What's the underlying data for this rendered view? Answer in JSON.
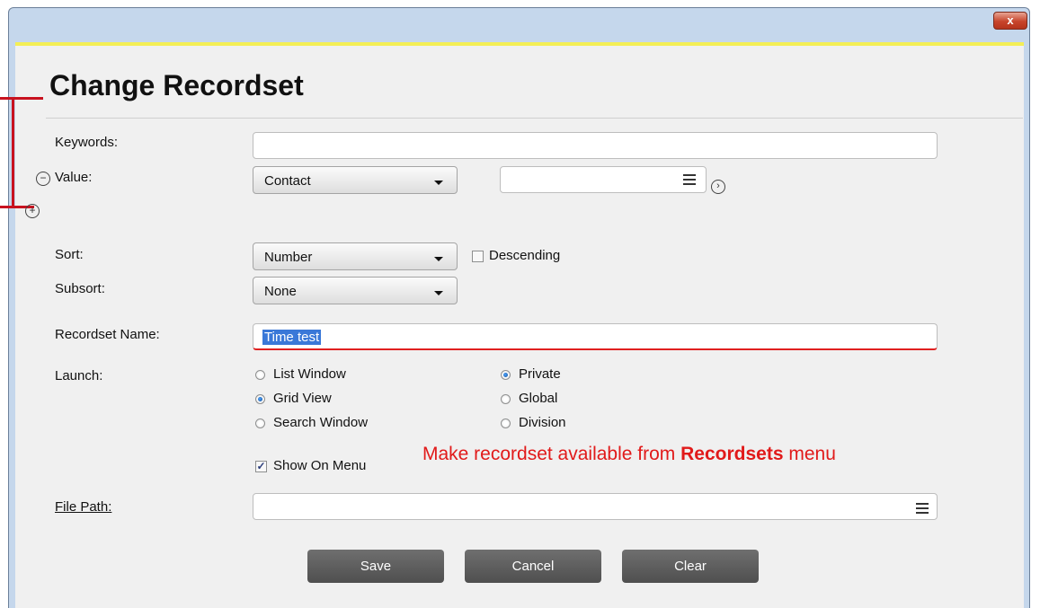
{
  "dialog": {
    "title": "Change Recordset",
    "close_glyph": "x"
  },
  "form": {
    "keywords_label": "Keywords:",
    "keywords_value": "",
    "value_label": "Value:",
    "value_dropdown": "Contact",
    "value_input": "",
    "sort_label": "Sort:",
    "sort_value": "Number",
    "descending_label": "Descending",
    "descending_checked": false,
    "subsort_label": "Subsort:",
    "subsort_value": "None",
    "recordset_name_label": "Recordset Name:",
    "recordset_name_value": "Time test",
    "launch_label": "Launch:",
    "launch_options": [
      "List Window",
      "Grid View",
      "Search Window"
    ],
    "launch_selected": "Grid View",
    "scope_options": [
      "Private",
      "Global",
      "Division"
    ],
    "scope_selected": "Private",
    "show_on_menu_label": "Show On Menu",
    "show_on_menu_checked": true,
    "file_path_label": "File Path:",
    "file_path_value": ""
  },
  "buttons": {
    "save": "Save",
    "cancel": "Cancel",
    "clear": "Clear"
  },
  "annotation": {
    "text_before": "Make recordset available from ",
    "text_bold": "Recordsets",
    "text_after": " menu",
    "color": "#e11a1a"
  },
  "icons": {
    "remove": "minus-circle-icon",
    "add": "plus-circle-icon",
    "next": "chevron-right-circle-icon",
    "list": "list-lines-icon",
    "close": "close-icon"
  },
  "colors": {
    "accent_yellow": "#f3ee55",
    "button_gray": "#5c5c5c",
    "annotation_red": "#e11a1a"
  }
}
